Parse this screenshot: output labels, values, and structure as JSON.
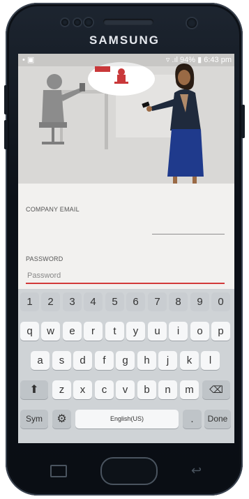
{
  "device": {
    "brand": "SAMSUNG"
  },
  "status_bar": {
    "left_icons": "• ▣",
    "battery": "94%",
    "time": "6:43 pm"
  },
  "form": {
    "email_label": "COMPANY EMAIL",
    "email_value": "",
    "password_label": "PASSWORD",
    "password_placeholder": "Password"
  },
  "keyboard": {
    "numbers": [
      "1",
      "2",
      "3",
      "4",
      "5",
      "6",
      "7",
      "8",
      "9",
      "0"
    ],
    "row1": [
      "q",
      "w",
      "e",
      "r",
      "t",
      "y",
      "u",
      "i",
      "o",
      "p"
    ],
    "row2": [
      "a",
      "s",
      "d",
      "f",
      "g",
      "h",
      "j",
      "k",
      "l"
    ],
    "row3": [
      "z",
      "x",
      "c",
      "v",
      "b",
      "n",
      "m"
    ],
    "sym_label": "Sym",
    "space_label": "English(US)",
    "period_label": ".",
    "done_label": "Done"
  },
  "colors": {
    "accent": "#d23a3a",
    "blazer": "#1f2a3c",
    "skirt": "#1f3a8c"
  }
}
